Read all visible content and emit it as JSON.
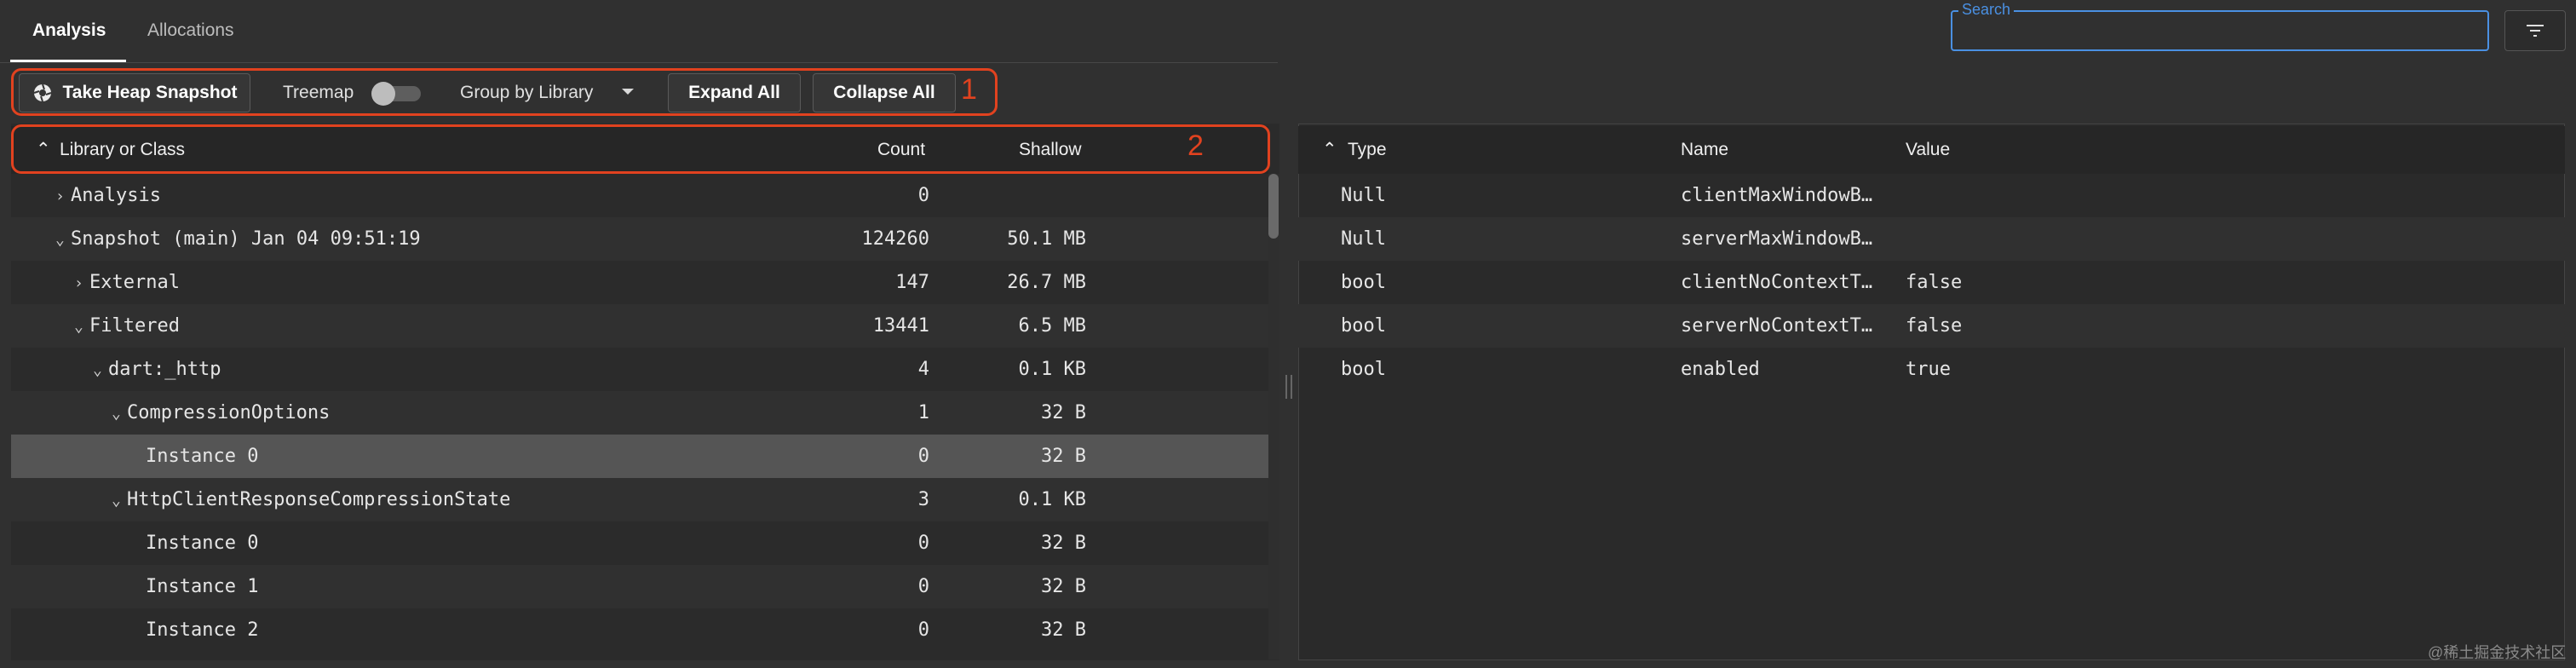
{
  "tabs": [
    {
      "label": "Analysis",
      "active": true
    },
    {
      "label": "Allocations",
      "active": false
    }
  ],
  "search": {
    "label": "Search",
    "value": ""
  },
  "filter_icon": "filter-icon",
  "toolbar": {
    "snapshot_label": "Take Heap Snapshot",
    "treemap_label": "Treemap",
    "treemap_on": false,
    "group_label": "Group by Library",
    "expand_label": "Expand All",
    "collapse_label": "Collapse All",
    "annotation": "1"
  },
  "left_table": {
    "annotation": "2",
    "headers": {
      "name": "Library or Class",
      "count": "Count",
      "shallow": "Shallow"
    },
    "rows": [
      {
        "indent": 0,
        "chevron": "›",
        "name": "Analysis",
        "count": "0",
        "shallow": ""
      },
      {
        "indent": 0,
        "chevron": "⌄",
        "name": "Snapshot (main) Jan 04 09:51:19",
        "count": "124260",
        "shallow": "50.1 MB"
      },
      {
        "indent": 1,
        "chevron": "›",
        "name": "External",
        "count": "147",
        "shallow": "26.7 MB"
      },
      {
        "indent": 1,
        "chevron": "⌄",
        "name": "Filtered",
        "count": "13441",
        "shallow": "6.5 MB"
      },
      {
        "indent": 2,
        "chevron": "⌄",
        "name": "dart:_http",
        "count": "4",
        "shallow": "0.1 KB"
      },
      {
        "indent": 3,
        "chevron": "⌄",
        "name": "CompressionOptions",
        "count": "1",
        "shallow": "32 B"
      },
      {
        "indent": 4,
        "chevron": "",
        "name": "Instance 0",
        "count": "0",
        "shallow": "32 B",
        "selected": true
      },
      {
        "indent": 3,
        "chevron": "⌄",
        "name": "HttpClientResponseCompressionState",
        "count": "3",
        "shallow": "0.1 KB"
      },
      {
        "indent": 4,
        "chevron": "",
        "name": "Instance 0",
        "count": "0",
        "shallow": "32 B"
      },
      {
        "indent": 4,
        "chevron": "",
        "name": "Instance 1",
        "count": "0",
        "shallow": "32 B"
      },
      {
        "indent": 4,
        "chevron": "",
        "name": "Instance 2",
        "count": "0",
        "shallow": "32 B"
      }
    ]
  },
  "right_table": {
    "headers": {
      "type": "Type",
      "name": "Name",
      "value": "Value"
    },
    "rows": [
      {
        "type": "Null",
        "name": "clientMaxWindowB…",
        "value": ""
      },
      {
        "type": "Null",
        "name": "serverMaxWindowB…",
        "value": ""
      },
      {
        "type": "bool",
        "name": "clientNoContextT…",
        "value": "false"
      },
      {
        "type": "bool",
        "name": "serverNoContextT…",
        "value": "false"
      },
      {
        "type": "bool",
        "name": "enabled",
        "value": "true"
      }
    ]
  },
  "watermark": "@稀土掘金技术社区"
}
